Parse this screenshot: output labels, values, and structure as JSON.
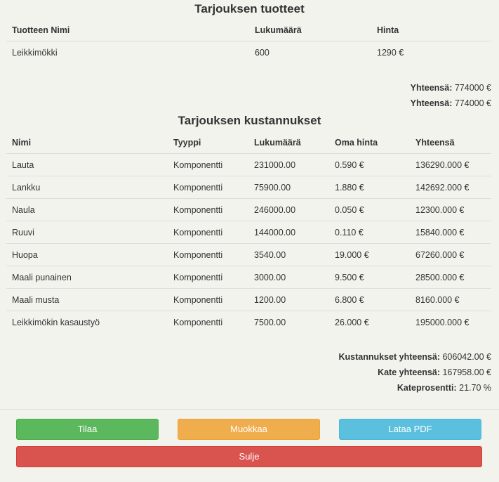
{
  "products": {
    "title": "Tarjouksen tuotteet",
    "headers": [
      "Tuotteen Nimi",
      "Lukumäärä",
      "Hinta"
    ],
    "rows": [
      [
        "Leikkimökki",
        "600",
        "1290 €"
      ]
    ],
    "totals": [
      {
        "label": "Yhteensä:",
        "value": "774000 €"
      },
      {
        "label": "Yhteensä:",
        "value": "774000 €"
      }
    ]
  },
  "costs": {
    "title": "Tarjouksen kustannukset",
    "headers": [
      "Nimi",
      "Tyyppi",
      "Lukumäärä",
      "Oma hinta",
      "Yhteensä"
    ],
    "rows": [
      [
        "Lauta",
        "Komponentti",
        "231000.00",
        "0.590 €",
        "136290.000 €"
      ],
      [
        "Lankku",
        "Komponentti",
        "75900.00",
        "1.880 €",
        "142692.000 €"
      ],
      [
        "Naula",
        "Komponentti",
        "246000.00",
        "0.050 €",
        "12300.000 €"
      ],
      [
        "Ruuvi",
        "Komponentti",
        "144000.00",
        "0.110 €",
        "15840.000 €"
      ],
      [
        "Huopa",
        "Komponentti",
        "3540.00",
        "19.000 €",
        "67260.000 €"
      ],
      [
        "Maali punainen",
        "Komponentti",
        "3000.00",
        "9.500 €",
        "28500.000 €"
      ],
      [
        "Maali musta",
        "Komponentti",
        "1200.00",
        "6.800 €",
        "8160.000 €"
      ],
      [
        "Leikkimökin kasaustyö",
        "Komponentti",
        "7500.00",
        "26.000 €",
        "195000.000 €"
      ]
    ],
    "totals": [
      {
        "label": "Kustannukset yhteensä:",
        "value": "606042.00 €"
      },
      {
        "label": "Kate yhteensä:",
        "value": "167958.00 €"
      },
      {
        "label": "Kateprosentti:",
        "value": "21.70 %"
      }
    ]
  },
  "buttons": {
    "order": "Tilaa",
    "edit": "Muokkaa",
    "pdf": "Lataa PDF",
    "close": "Sulje"
  }
}
